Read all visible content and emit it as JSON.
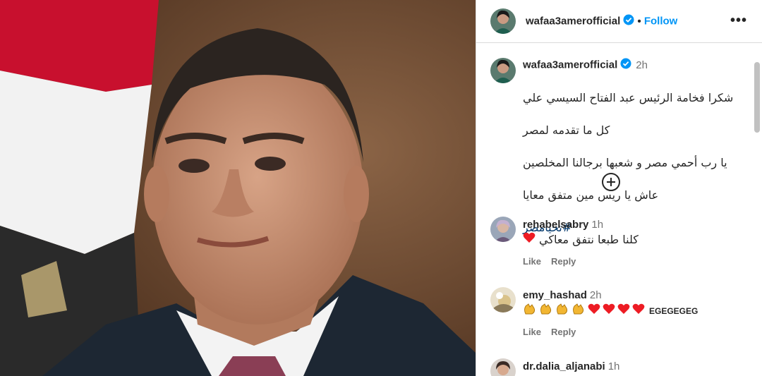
{
  "post": {
    "username": "wafaa3amerofficial",
    "follow_label": "Follow",
    "more_label": "•••",
    "caption_time": "2h",
    "caption_lines": [
      "شكرا فخامة الرئيس عبد الفتاح السيسي علي",
      "كل ما تقدمه لمصر",
      "يا رب أحمي مصر و شعبها برجالنا المخلصين",
      "عاش يا ريس مين متفق معايا"
    ],
    "hashtag": "#تحيامصر"
  },
  "comments": [
    {
      "username": "rehabelsabry",
      "time": "1h",
      "text": "كلنا طبعا نتفق معاكي",
      "like": "Like",
      "reply": "Reply"
    },
    {
      "username": "emy_hashad",
      "time": "2h",
      "text": "EGEGEGEG",
      "like": "Like",
      "reply": "Reply"
    },
    {
      "username": "dr.dalia_aljanabi",
      "time": "1h"
    }
  ],
  "icons": {
    "verified": "verified-badge-icon",
    "load_more": "plus-circle-icon",
    "clap": "clapping-hands-icon",
    "heart": "red-heart-icon"
  },
  "colors": {
    "accent": "#0095f6",
    "heart": "#ed1c24",
    "hashtag": "#00376b"
  }
}
